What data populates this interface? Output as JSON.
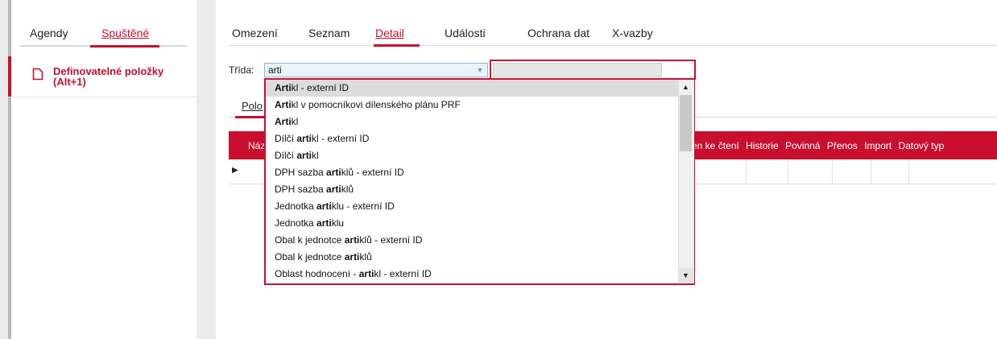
{
  "sidebar": {
    "tabs": [
      {
        "label": "Agendy"
      },
      {
        "label": "Spuštěné"
      }
    ],
    "items": [
      {
        "label": "Definovatelné položky (Alt+1)"
      }
    ]
  },
  "main": {
    "tabs": [
      {
        "label": "Omezení"
      },
      {
        "label": "Seznam"
      },
      {
        "label": "Detail"
      },
      {
        "label": "Události"
      },
      {
        "label": "Ochrana dat"
      },
      {
        "label": "X-vazby"
      }
    ],
    "class_label": "Třída:",
    "class_input_value": "arti",
    "subtab_label": "Polo",
    "grid": {
      "first_column": "Náz",
      "columns": [
        "en ke čtení",
        "Historie",
        "Povinná",
        "Přenos",
        "Import",
        "Datový typ"
      ]
    }
  },
  "dropdown": {
    "items": [
      {
        "pre": "",
        "match": "Arti",
        "post": "kl - externí ID"
      },
      {
        "pre": "",
        "match": "Arti",
        "post": "kl v pomocníkovi dílenského plánu PRF"
      },
      {
        "pre": "",
        "match": "Arti",
        "post": "kl"
      },
      {
        "pre": "Dílčí ",
        "match": "arti",
        "post": "kl - externí ID"
      },
      {
        "pre": "Dílčí ",
        "match": "arti",
        "post": "kl"
      },
      {
        "pre": "DPH sazba ",
        "match": "arti",
        "post": "klů - externí ID"
      },
      {
        "pre": "DPH sazba ",
        "match": "arti",
        "post": "klů"
      },
      {
        "pre": "Jednotka ",
        "match": "arti",
        "post": "klu - externí ID"
      },
      {
        "pre": "Jednotka ",
        "match": "arti",
        "post": "klu"
      },
      {
        "pre": "Obal k jednotce ",
        "match": "arti",
        "post": "klů - externí ID"
      },
      {
        "pre": "Obal k jednotce ",
        "match": "arti",
        "post": "klů"
      },
      {
        "pre": "Oblast hodnocení - ",
        "match": "arti",
        "post": "kl - externí ID"
      }
    ],
    "selected_index": 0
  },
  "colors": {
    "accent": "#c8102e",
    "input_bg": "#e8f3fb"
  }
}
